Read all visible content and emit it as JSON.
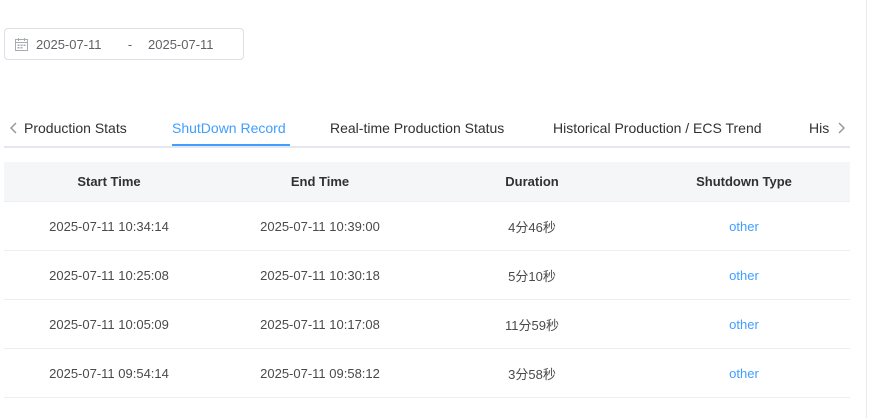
{
  "date_range": {
    "start": "2025-07-11",
    "separator": "-",
    "end": "2025-07-11"
  },
  "tabs": [
    {
      "label": "Production Stats"
    },
    {
      "label": "ShutDown Record"
    },
    {
      "label": "Real-time Production Status"
    },
    {
      "label": "Historical Production / ECS Trend"
    },
    {
      "label": "His"
    }
  ],
  "active_tab": "ShutDown Record",
  "table": {
    "columns": [
      "Start Time",
      "End Time",
      "Duration",
      "Shutdown Type"
    ],
    "rows": [
      {
        "start": "2025-07-11 10:34:14",
        "end": "2025-07-11 10:39:00",
        "duration": "4分46秒",
        "type": "other"
      },
      {
        "start": "2025-07-11 10:25:08",
        "end": "2025-07-11 10:30:18",
        "duration": "5分10秒",
        "type": "other"
      },
      {
        "start": "2025-07-11 10:05:09",
        "end": "2025-07-11 10:17:08",
        "duration": "11分59秒",
        "type": "other"
      },
      {
        "start": "2025-07-11 09:54:14",
        "end": "2025-07-11 09:58:12",
        "duration": "3分58秒",
        "type": "other"
      }
    ]
  },
  "colors": {
    "accent": "#409eff",
    "header_bg": "#f5f6f8",
    "border": "#ebeef5"
  },
  "icons": {
    "calendar": "calendar-icon",
    "prev": "chevron-left-icon",
    "next": "chevron-right-icon"
  }
}
